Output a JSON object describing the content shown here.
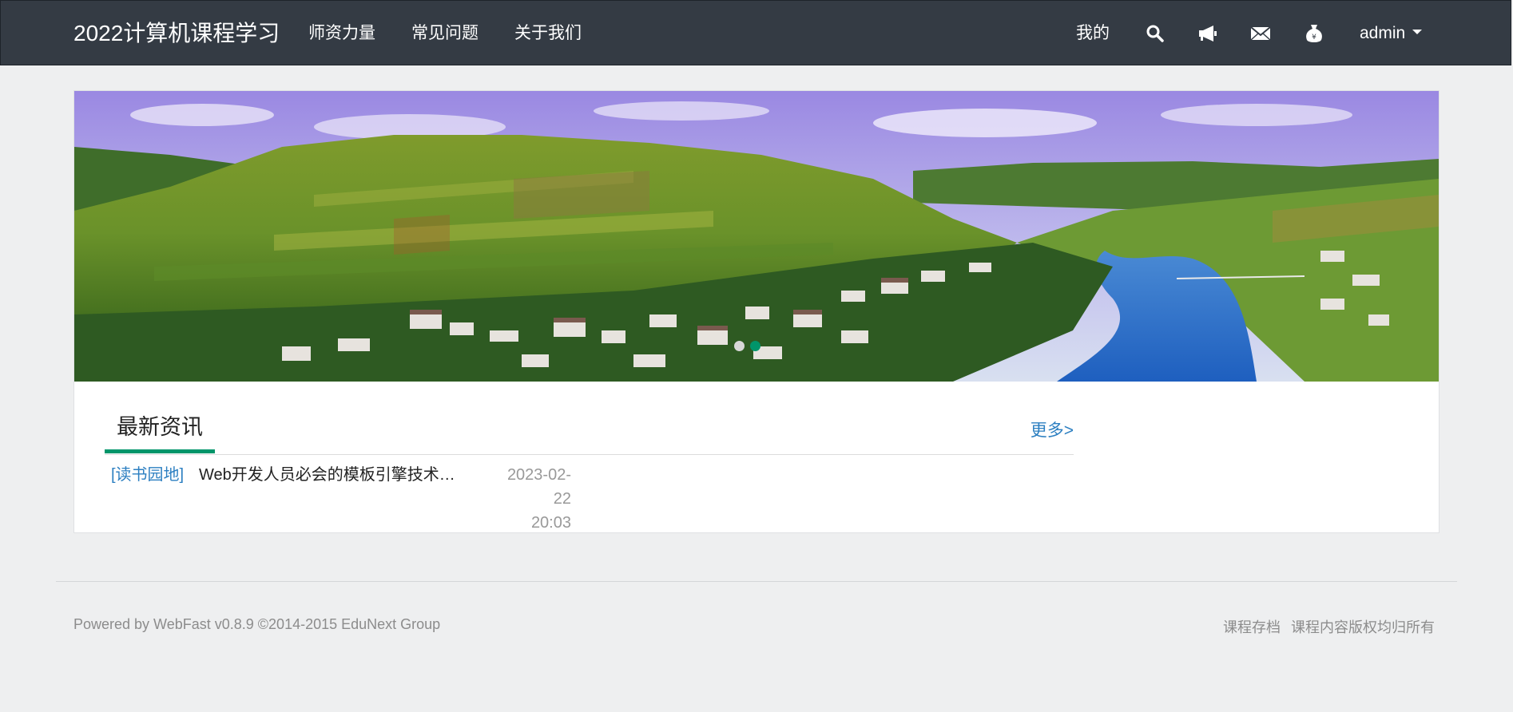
{
  "navbar": {
    "brand": "2022计算机课程学习",
    "links": [
      "师资力量",
      "常见问题",
      "关于我们"
    ],
    "mine": "我的",
    "icons": [
      "search-icon",
      "megaphone-icon",
      "envelope-icon",
      "money-bag-icon"
    ],
    "user": "admin",
    "bg_color": "#343b44"
  },
  "news": {
    "title": "最新资讯",
    "more": "更多>",
    "accent_color": "#00956a",
    "items": [
      {
        "category": "[读书园地]",
        "text": "Web开发人员必会的模板引擎技术…",
        "date": "2023-02-22",
        "time": "20:03"
      }
    ]
  },
  "footer": {
    "powered": "Powered by WebFast v0.8.9 ©2014-2015 EduNext Group",
    "links": [
      "课程存档",
      "课程内容版权均归所有"
    ]
  }
}
